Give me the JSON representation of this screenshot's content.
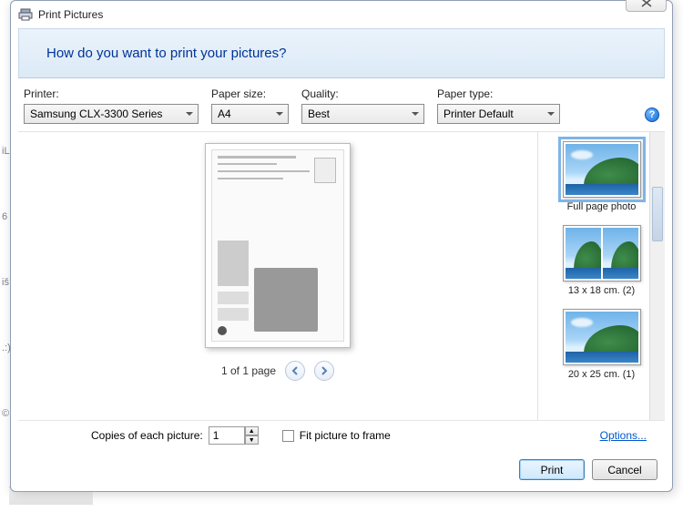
{
  "window": {
    "title": "Print Pictures",
    "close_label": "Close"
  },
  "header": {
    "question": "How do you want to print your pictures?"
  },
  "selectors": {
    "printer": {
      "label": "Printer:",
      "value": "Samsung CLX-3300 Series"
    },
    "paper_size": {
      "label": "Paper size:",
      "value": "A4"
    },
    "quality": {
      "label": "Quality:",
      "value": "Best"
    },
    "paper_type": {
      "label": "Paper type:",
      "value": "Printer Default"
    }
  },
  "help_icon": "?",
  "preview": {
    "page_info": "1 of 1 page"
  },
  "layouts": [
    {
      "caption": "Full page photo",
      "selected": true,
      "cols": 1
    },
    {
      "caption": "13 x 18 cm. (2)",
      "selected": false,
      "cols": 2
    },
    {
      "caption": "20 x 25 cm. (1)",
      "selected": false,
      "cols": 1
    }
  ],
  "options": {
    "copies_label": "Copies of each picture:",
    "copies_value": "1",
    "fit_label": "Fit picture to frame",
    "fit_checked": false,
    "options_link": "Options..."
  },
  "buttons": {
    "print": "Print",
    "cancel": "Cancel"
  }
}
